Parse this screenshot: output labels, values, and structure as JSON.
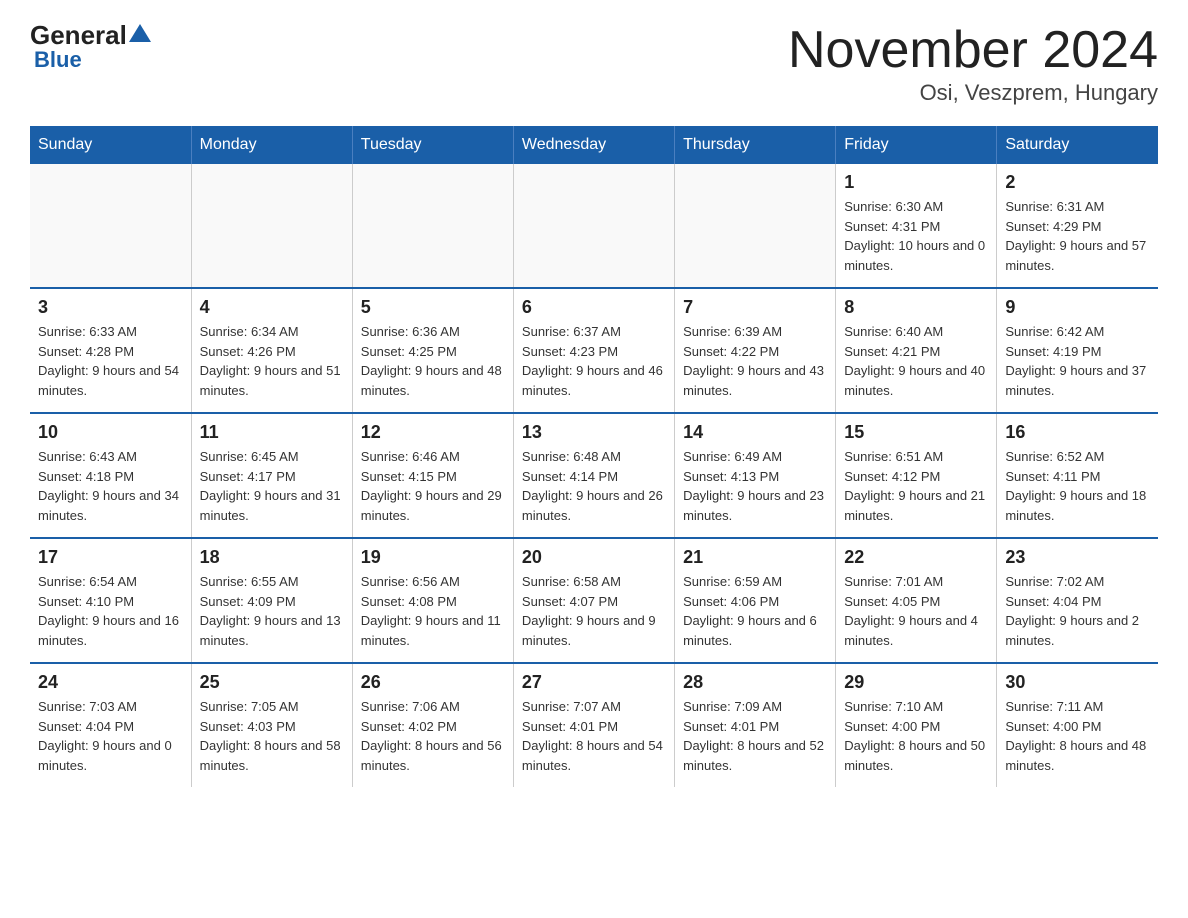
{
  "logo": {
    "general": "General",
    "arrow": "▲",
    "blue": "Blue"
  },
  "title": "November 2024",
  "subtitle": "Osi, Veszprem, Hungary",
  "weekdays": [
    "Sunday",
    "Monday",
    "Tuesday",
    "Wednesday",
    "Thursday",
    "Friday",
    "Saturday"
  ],
  "weeks": [
    [
      {
        "day": "",
        "info": ""
      },
      {
        "day": "",
        "info": ""
      },
      {
        "day": "",
        "info": ""
      },
      {
        "day": "",
        "info": ""
      },
      {
        "day": "",
        "info": ""
      },
      {
        "day": "1",
        "info": "Sunrise: 6:30 AM\nSunset: 4:31 PM\nDaylight: 10 hours and 0 minutes."
      },
      {
        "day": "2",
        "info": "Sunrise: 6:31 AM\nSunset: 4:29 PM\nDaylight: 9 hours and 57 minutes."
      }
    ],
    [
      {
        "day": "3",
        "info": "Sunrise: 6:33 AM\nSunset: 4:28 PM\nDaylight: 9 hours and 54 minutes."
      },
      {
        "day": "4",
        "info": "Sunrise: 6:34 AM\nSunset: 4:26 PM\nDaylight: 9 hours and 51 minutes."
      },
      {
        "day": "5",
        "info": "Sunrise: 6:36 AM\nSunset: 4:25 PM\nDaylight: 9 hours and 48 minutes."
      },
      {
        "day": "6",
        "info": "Sunrise: 6:37 AM\nSunset: 4:23 PM\nDaylight: 9 hours and 46 minutes."
      },
      {
        "day": "7",
        "info": "Sunrise: 6:39 AM\nSunset: 4:22 PM\nDaylight: 9 hours and 43 minutes."
      },
      {
        "day": "8",
        "info": "Sunrise: 6:40 AM\nSunset: 4:21 PM\nDaylight: 9 hours and 40 minutes."
      },
      {
        "day": "9",
        "info": "Sunrise: 6:42 AM\nSunset: 4:19 PM\nDaylight: 9 hours and 37 minutes."
      }
    ],
    [
      {
        "day": "10",
        "info": "Sunrise: 6:43 AM\nSunset: 4:18 PM\nDaylight: 9 hours and 34 minutes."
      },
      {
        "day": "11",
        "info": "Sunrise: 6:45 AM\nSunset: 4:17 PM\nDaylight: 9 hours and 31 minutes."
      },
      {
        "day": "12",
        "info": "Sunrise: 6:46 AM\nSunset: 4:15 PM\nDaylight: 9 hours and 29 minutes."
      },
      {
        "day": "13",
        "info": "Sunrise: 6:48 AM\nSunset: 4:14 PM\nDaylight: 9 hours and 26 minutes."
      },
      {
        "day": "14",
        "info": "Sunrise: 6:49 AM\nSunset: 4:13 PM\nDaylight: 9 hours and 23 minutes."
      },
      {
        "day": "15",
        "info": "Sunrise: 6:51 AM\nSunset: 4:12 PM\nDaylight: 9 hours and 21 minutes."
      },
      {
        "day": "16",
        "info": "Sunrise: 6:52 AM\nSunset: 4:11 PM\nDaylight: 9 hours and 18 minutes."
      }
    ],
    [
      {
        "day": "17",
        "info": "Sunrise: 6:54 AM\nSunset: 4:10 PM\nDaylight: 9 hours and 16 minutes."
      },
      {
        "day": "18",
        "info": "Sunrise: 6:55 AM\nSunset: 4:09 PM\nDaylight: 9 hours and 13 minutes."
      },
      {
        "day": "19",
        "info": "Sunrise: 6:56 AM\nSunset: 4:08 PM\nDaylight: 9 hours and 11 minutes."
      },
      {
        "day": "20",
        "info": "Sunrise: 6:58 AM\nSunset: 4:07 PM\nDaylight: 9 hours and 9 minutes."
      },
      {
        "day": "21",
        "info": "Sunrise: 6:59 AM\nSunset: 4:06 PM\nDaylight: 9 hours and 6 minutes."
      },
      {
        "day": "22",
        "info": "Sunrise: 7:01 AM\nSunset: 4:05 PM\nDaylight: 9 hours and 4 minutes."
      },
      {
        "day": "23",
        "info": "Sunrise: 7:02 AM\nSunset: 4:04 PM\nDaylight: 9 hours and 2 minutes."
      }
    ],
    [
      {
        "day": "24",
        "info": "Sunrise: 7:03 AM\nSunset: 4:04 PM\nDaylight: 9 hours and 0 minutes."
      },
      {
        "day": "25",
        "info": "Sunrise: 7:05 AM\nSunset: 4:03 PM\nDaylight: 8 hours and 58 minutes."
      },
      {
        "day": "26",
        "info": "Sunrise: 7:06 AM\nSunset: 4:02 PM\nDaylight: 8 hours and 56 minutes."
      },
      {
        "day": "27",
        "info": "Sunrise: 7:07 AM\nSunset: 4:01 PM\nDaylight: 8 hours and 54 minutes."
      },
      {
        "day": "28",
        "info": "Sunrise: 7:09 AM\nSunset: 4:01 PM\nDaylight: 8 hours and 52 minutes."
      },
      {
        "day": "29",
        "info": "Sunrise: 7:10 AM\nSunset: 4:00 PM\nDaylight: 8 hours and 50 minutes."
      },
      {
        "day": "30",
        "info": "Sunrise: 7:11 AM\nSunset: 4:00 PM\nDaylight: 8 hours and 48 minutes."
      }
    ]
  ]
}
